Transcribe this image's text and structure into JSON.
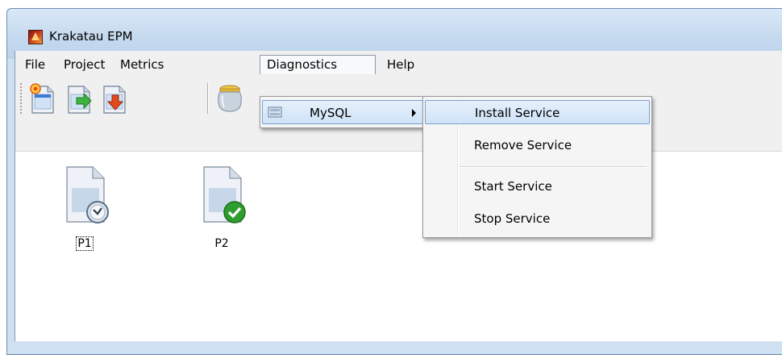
{
  "window": {
    "title": "Krakatau EPM"
  },
  "menubar": {
    "items": [
      {
        "label": "File"
      },
      {
        "label": "Project"
      },
      {
        "label": "Metrics"
      },
      {
        "label": "Diagnostics"
      },
      {
        "label": "Help"
      }
    ]
  },
  "diagnostics_menu": {
    "items": [
      {
        "label": "MySQL",
        "icon": "database-icon",
        "has_submenu": true
      }
    ]
  },
  "mysql_submenu": {
    "items": [
      {
        "label": "Install Service",
        "highlighted": true
      },
      {
        "label": "Remove Service"
      },
      {
        "label": "Start Service"
      },
      {
        "label": "Stop Service"
      }
    ]
  },
  "toolbar": {
    "buttons": [
      {
        "icon": "new-document-icon"
      },
      {
        "icon": "import-document-icon"
      },
      {
        "icon": "export-document-icon"
      },
      {
        "icon": "jar-icon"
      }
    ]
  },
  "projects": [
    {
      "label": "P1",
      "status_icon": "clock-icon",
      "selected": true
    },
    {
      "label": "P2",
      "status_icon": "checkmark-icon",
      "selected": false
    }
  ],
  "colors": {
    "highlight_border": "#7da2ce",
    "check_green": "#2f9e2f",
    "export_red": "#e24a1c",
    "import_green": "#3fb33f"
  }
}
